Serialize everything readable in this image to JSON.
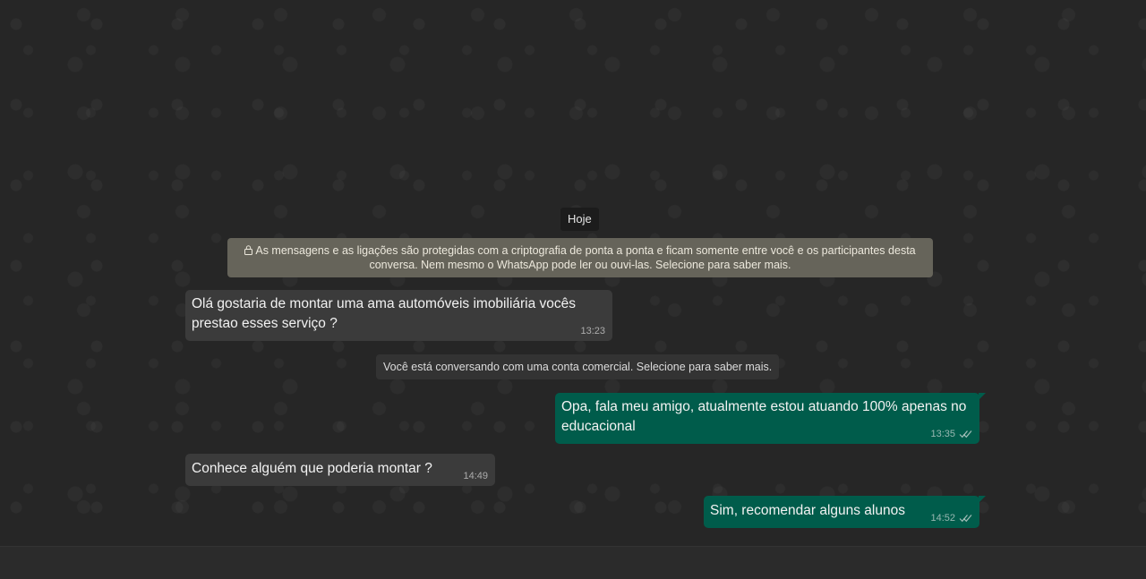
{
  "chat": {
    "date_label": "Hoje",
    "encryption_notice": "As mensagens e as ligações são protegidas com a criptografia de ponta a ponta e ficam somente entre você e os participantes desta conversa. Nem mesmo o WhatsApp pode ler ou ouvi-las. Selecione para saber mais.",
    "business_notice": "Você está conversando com uma conta comercial. Selecione para saber mais.",
    "messages": [
      {
        "direction": "incoming",
        "text": "Olá gostaria de montar uma ama automóveis imobiliária vocês prestao esses serviço ?",
        "time": "13:23"
      },
      {
        "direction": "outgoing",
        "text": "Opa, fala meu amigo, atualmente estou atuando 100% apenas no educacional",
        "time": "13:35",
        "status": "read"
      },
      {
        "direction": "incoming",
        "text": "Conhece alguém que poderia montar ?",
        "time": "14:49"
      },
      {
        "direction": "outgoing",
        "text": "Sim, recomendar alguns alunos",
        "time": "14:52",
        "status": "read"
      }
    ]
  },
  "colors": {
    "background": "#262626",
    "incoming_bubble": "#3b3b3b",
    "outgoing_bubble": "#005c4b",
    "encryption_notice_bg": "#66645a"
  },
  "icons": {
    "lock": "lock-icon",
    "read_receipt": "double-check-icon"
  }
}
